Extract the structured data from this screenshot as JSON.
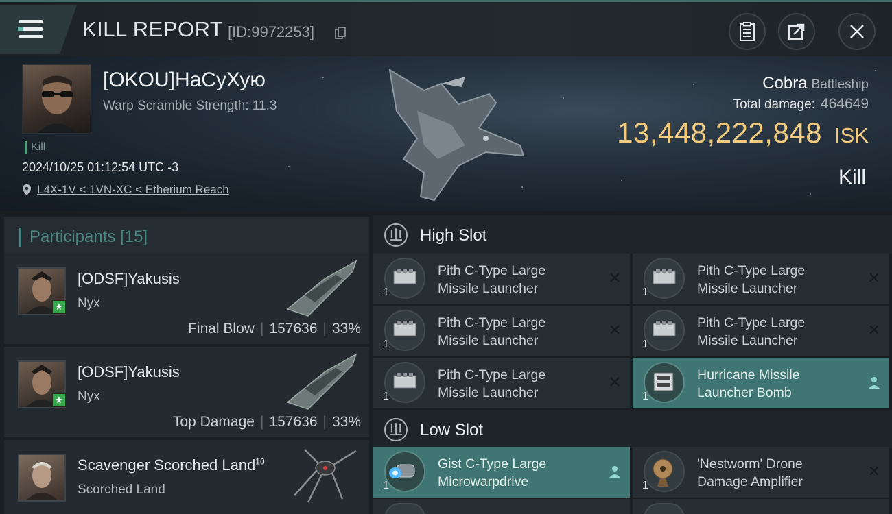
{
  "header": {
    "title": "KILL REPORT",
    "report_id": "[ID:9972253]",
    "icons": [
      "menu-icon",
      "copy-icon",
      "clipboard-icon",
      "share-icon",
      "close-icon"
    ]
  },
  "victim": {
    "name": "[OKOU]НаСуХую",
    "warp_scramble": "Warp Scramble Strength: 11.3",
    "tag": "Kill",
    "datetime": "2024/10/25 01:12:54 UTC -3",
    "location": "L4X-1V < 1VN-XC < Etherium Reach",
    "ship_name": "Cobra",
    "ship_class": "Battleship",
    "total_damage_label": "Total damage:",
    "total_damage": "464649",
    "isk_value": "13,448,222,848",
    "isk_unit": "ISK",
    "result": "Kill"
  },
  "participants": {
    "title": "Participants [15]",
    "list": [
      {
        "name": "[ODSF]Yakusis",
        "ship": "Nyx",
        "role": "Final Blow",
        "damage": "157636",
        "percent": "33%"
      },
      {
        "name": "[ODSF]Yakusis",
        "ship": "Nyx",
        "role": "Top Damage",
        "damage": "157636",
        "percent": "33%"
      },
      {
        "name": "Scavenger Scorched Land",
        "name_sup": "10",
        "ship": "Scorched Land",
        "role": "",
        "damage": "",
        "percent": ""
      }
    ]
  },
  "slots": {
    "high": {
      "title": "High Slot",
      "items": [
        {
          "line1": "Pith C-Type Large",
          "line2": "Missile Launcher",
          "qty": "1",
          "action": "close",
          "highlight": false
        },
        {
          "line1": "Pith C-Type Large",
          "line2": "Missile Launcher",
          "qty": "1",
          "action": "close",
          "highlight": false
        },
        {
          "line1": "Pith C-Type Large",
          "line2": "Missile Launcher",
          "qty": "1",
          "action": "close",
          "highlight": false
        },
        {
          "line1": "Pith C-Type Large",
          "line2": "Missile Launcher",
          "qty": "1",
          "action": "close",
          "highlight": false
        },
        {
          "line1": "Pith C-Type Large",
          "line2": "Missile Launcher",
          "qty": "1",
          "action": "close",
          "highlight": false
        },
        {
          "line1": "Hurricane Missile",
          "line2": "Launcher Bomb",
          "qty": "1",
          "action": "person",
          "highlight": true
        }
      ]
    },
    "low": {
      "title": "Low Slot",
      "items": [
        {
          "line1": "Gist C-Type Large",
          "line2": "Microwarpdrive",
          "qty": "1",
          "action": "person",
          "highlight": true
        },
        {
          "line1": "'Nestworm' Drone",
          "line2": "Damage Amplifier",
          "qty": "1",
          "action": "close",
          "highlight": false
        }
      ]
    }
  },
  "colors": {
    "accent": "#4a8782",
    "isk_gold": "#f2cb7e",
    "highlight_item": "#3f7572",
    "badge_green": "#37a84d"
  }
}
